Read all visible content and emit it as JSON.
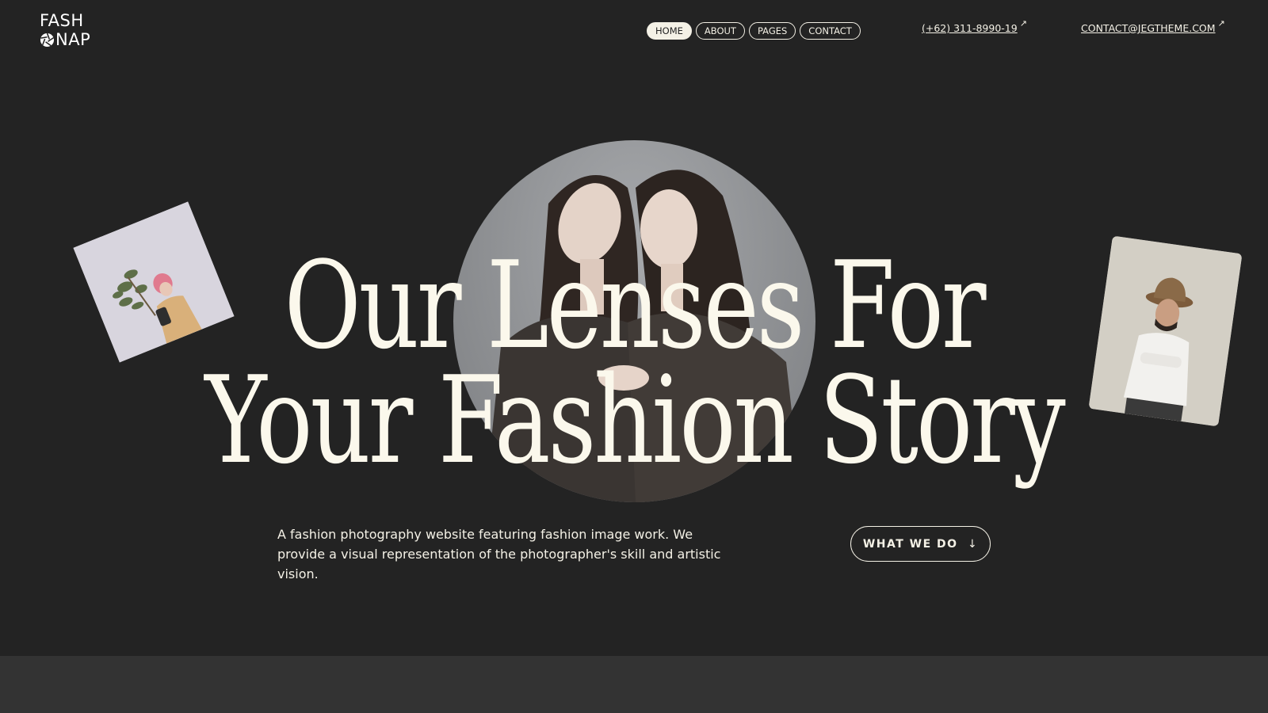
{
  "brand": {
    "line1": "FASH",
    "line2": "NAP",
    "logo_icon": "aperture-icon"
  },
  "nav": {
    "items": [
      {
        "label": "HOME",
        "active": true
      },
      {
        "label": "ABOUT",
        "active": false
      },
      {
        "label": "PAGES",
        "active": false
      },
      {
        "label": "CONTACT",
        "active": false
      }
    ]
  },
  "contacts": {
    "phone": "(+62) 311-8990-19",
    "email": "CONTACT@JEGTHEME.COM",
    "external_icon": "arrow-up-right-icon"
  },
  "hero": {
    "headline_line1": "Our Lenses For",
    "headline_line2": "Your Fashion Story",
    "description": "A fashion photography website featuring fashion image work. We provide a visual representation of the photographer's skill and artistic vision.",
    "cta_label": "WHAT WE DO",
    "cta_icon": "arrow-down-icon"
  },
  "colors": {
    "background": "#232323",
    "text": "#fbf8ec",
    "bottom_band": "#333333"
  }
}
